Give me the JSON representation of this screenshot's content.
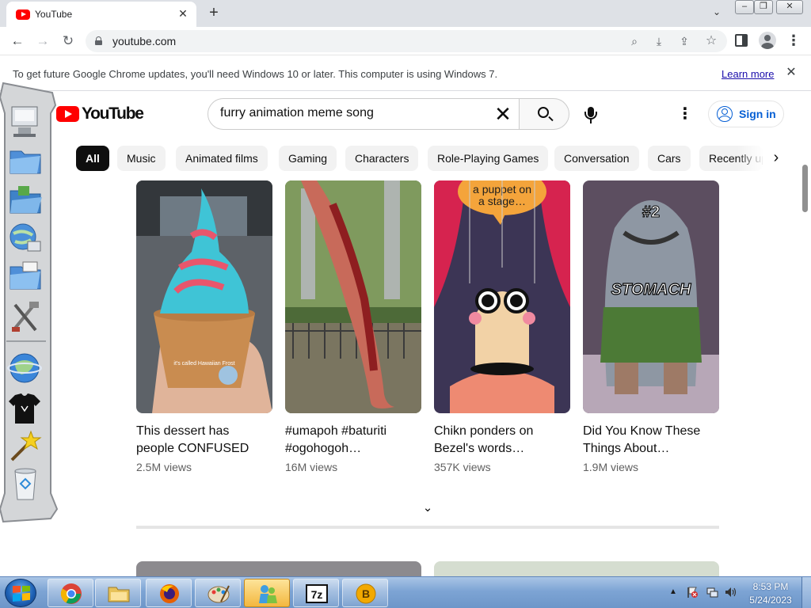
{
  "browser": {
    "tab": {
      "title": "YouTube",
      "favicon": "youtube-icon"
    },
    "new_tab_label": "+",
    "url": "youtube.com",
    "infobar": {
      "message": "To get future Google Chrome updates, you'll need Windows 10 or later. This computer is using Windows 7.",
      "link": "Learn more"
    }
  },
  "youtube": {
    "logo_text": "YouTube",
    "search_query": "furry animation meme song",
    "signin_label": "Sign in",
    "chips": [
      "All",
      "Music",
      "Animated films",
      "Gaming",
      "Characters",
      "Role-Playing Games",
      "Conversation",
      "Cars",
      "Recently uploaded"
    ],
    "active_chip": "All",
    "shorts": [
      {
        "title_line1": "This dessert has",
        "title_line2": "people CONFUSED",
        "views": "2.5M views",
        "overlay": "it's called Hawaiian Frost"
      },
      {
        "title_line1": "#umapoh #baturiti",
        "title_line2": "#ogohogoh…",
        "views": "16M views",
        "overlay": ""
      },
      {
        "title_line1": "Chikn ponders on",
        "title_line2": "Bezel's words…",
        "views": "357K views",
        "overlay": "a puppet on a stage…"
      },
      {
        "title_line1": "Did You Know These",
        "title_line2": "Things About…",
        "views": "1.9M views",
        "overlay_top": "#2",
        "overlay": "STOMACH"
      }
    ]
  },
  "taskbar": {
    "clock_time": "8:53 PM",
    "clock_date": "5/24/2023",
    "apps": [
      "chrome-icon",
      "explorer-icon",
      "firefox-icon",
      "paint-icon",
      "messenger-icon",
      "7zip-icon",
      "bitcoin-icon"
    ],
    "app_labels": {
      "sevenzip": "7z",
      "bitcoin": "B"
    }
  },
  "dock": {
    "icons": [
      "computer-icon",
      "folder-icon",
      "folder-open-icon",
      "globe-network-icon",
      "folder-pictures-icon",
      "tools-icon",
      "globe-icon",
      "tshirt-icon",
      "magic-wand-icon",
      "recycle-bin-icon"
    ]
  },
  "colors": {
    "youtube_red": "#ff0000",
    "link_blue": "#065fd4",
    "taskbar_blue": "#7da4d4"
  }
}
